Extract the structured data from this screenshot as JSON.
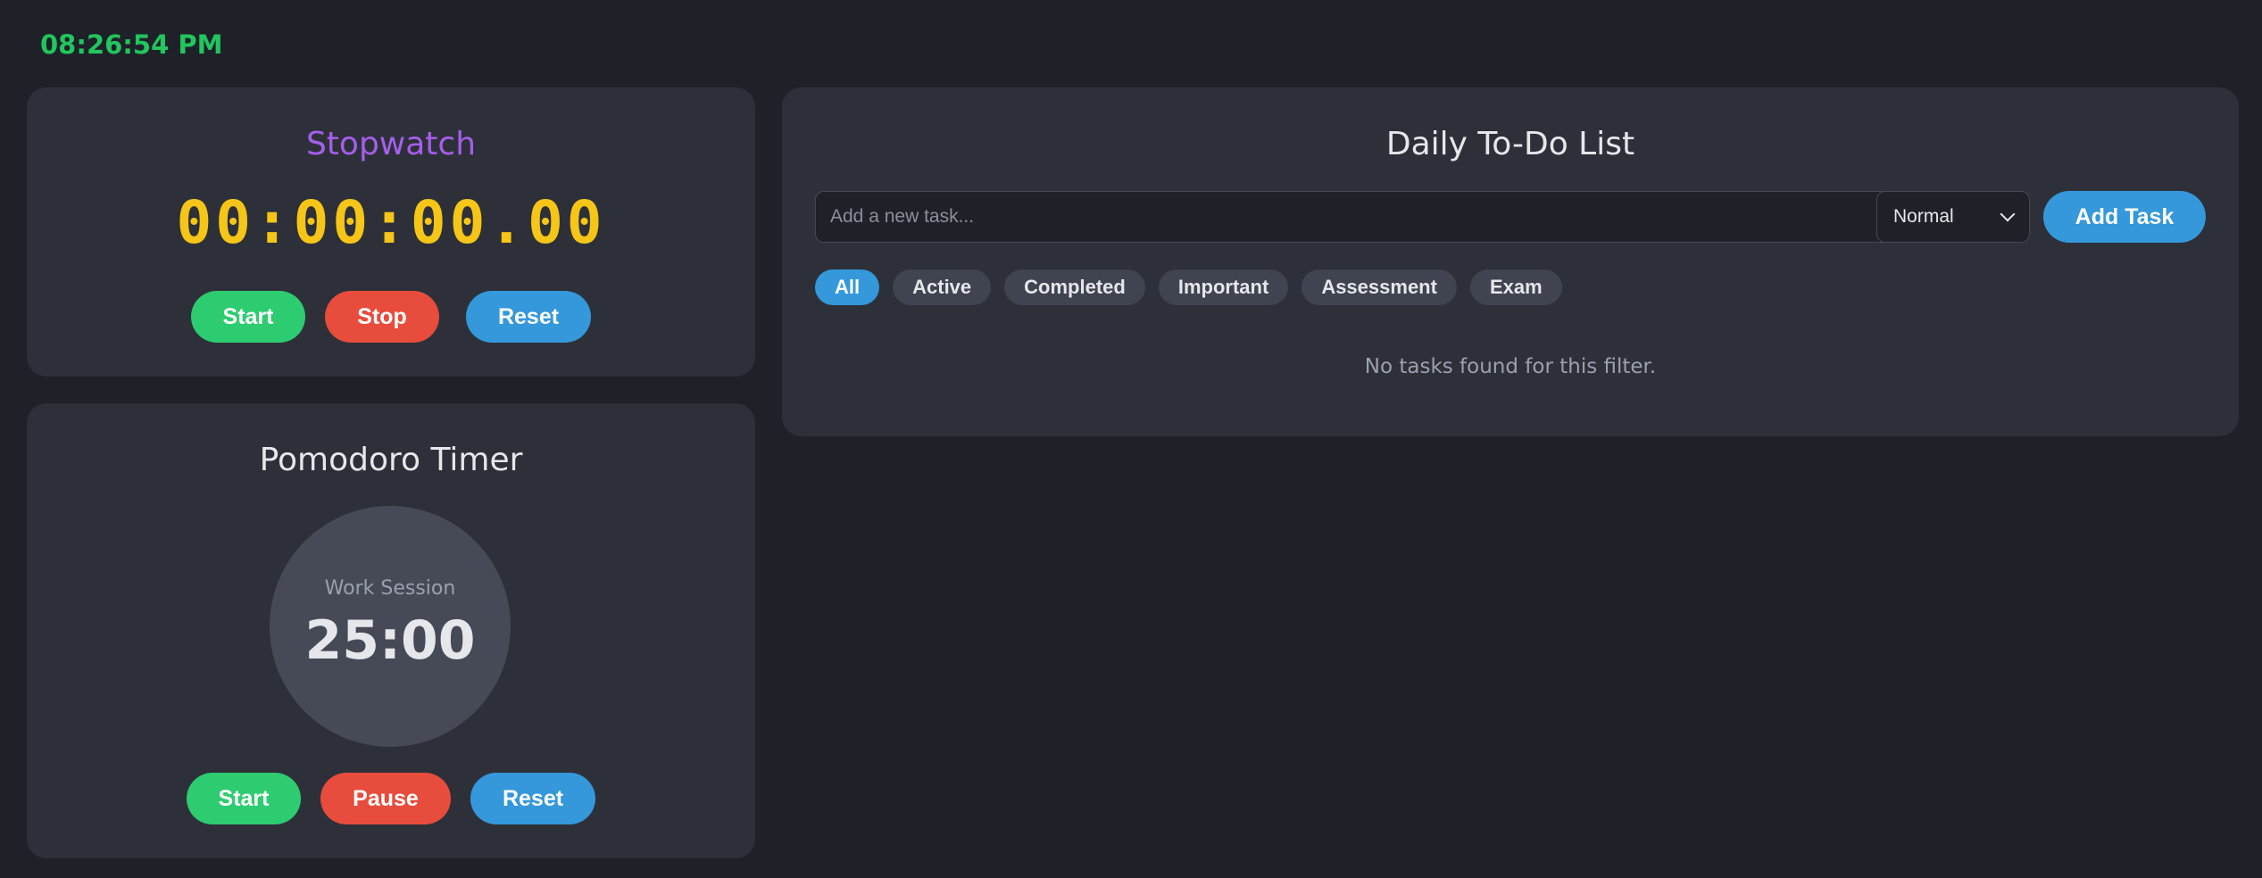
{
  "clock": {
    "time": "08:26:54 PM",
    "color": "#22c55e"
  },
  "stopwatch": {
    "title": "Stopwatch",
    "display": "00:00:00.00",
    "buttons": {
      "start": "Start",
      "stop": "Stop",
      "reset": "Reset"
    },
    "colors": {
      "title": "#a55eea",
      "display": "#f5c518"
    }
  },
  "pomodoro": {
    "title": "Pomodoro Timer",
    "session_label": "Work Session",
    "time": "25:00",
    "buttons": {
      "start": "Start",
      "pause": "Pause",
      "reset": "Reset"
    }
  },
  "todo": {
    "title": "Daily To-Do List",
    "input": {
      "placeholder": "Add a new task...",
      "value": ""
    },
    "priority": {
      "selected": "Normal"
    },
    "add_button": "Add Task",
    "filters": [
      {
        "label": "All",
        "active": true
      },
      {
        "label": "Active",
        "active": false
      },
      {
        "label": "Completed",
        "active": false
      },
      {
        "label": "Important",
        "active": false
      },
      {
        "label": "Assessment",
        "active": false
      },
      {
        "label": "Exam",
        "active": false
      }
    ],
    "empty_message": "No tasks found for this filter."
  },
  "colors": {
    "background": "#1f2129",
    "card": "#2d3039",
    "green": "#2ecc71",
    "red": "#e74c3c",
    "blue": "#3498db"
  }
}
